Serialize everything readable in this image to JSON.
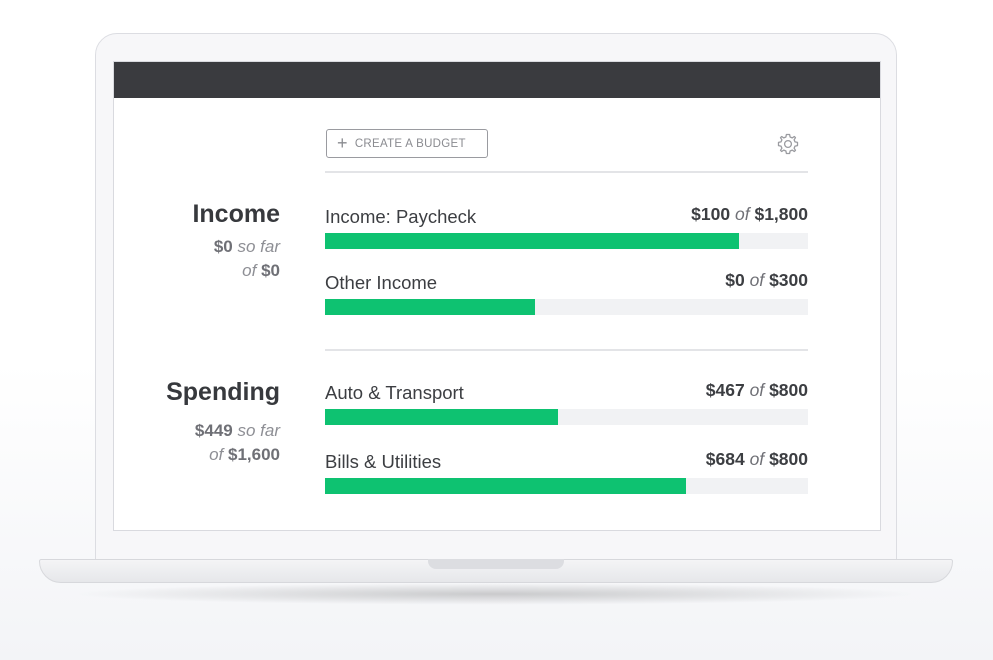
{
  "toolbar": {
    "create_label": "CREATE A BUDGET",
    "plus_icon": "plus-icon",
    "settings_icon": "gear-icon"
  },
  "income": {
    "title": "Income",
    "so_far_amount": "$0",
    "so_far_text": "so far",
    "of_text": "of",
    "total": "$0",
    "items": [
      {
        "name": "Income: Paycheck",
        "spent": "$100",
        "of": "of",
        "budget": "$1,800",
        "progress": 0.857
      },
      {
        "name": "Other Income",
        "spent": "$0",
        "of": "of",
        "budget": "$300",
        "progress": 0.435
      }
    ]
  },
  "spending": {
    "title": "Spending",
    "so_far_amount": "$449",
    "so_far_text": "so far",
    "of_text": "of",
    "total": "$1,600",
    "items": [
      {
        "name": "Auto & Transport",
        "spent": "$467",
        "of": "of",
        "budget": "$800",
        "progress": 0.483
      },
      {
        "name": "Bills & Utilities",
        "spent": "$684",
        "of": "of",
        "budget": "$800",
        "progress": 0.747
      }
    ]
  },
  "colors": {
    "progress_fill": "#0ec271",
    "progress_track": "#f1f2f4",
    "topbar": "#3a3b3f"
  }
}
